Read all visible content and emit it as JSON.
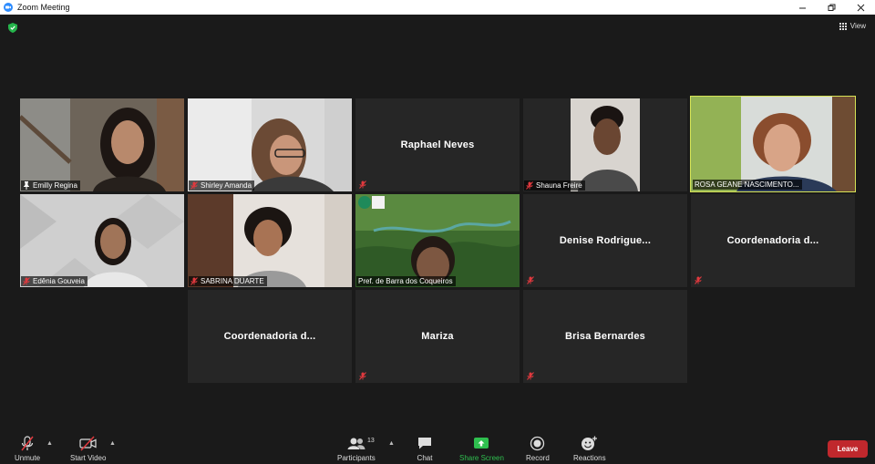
{
  "window": {
    "title": "Zoom Meeting",
    "app_icon": "zoom-camera-icon"
  },
  "top_bar": {
    "security_icon": "shield-check-icon",
    "view_label": "View"
  },
  "participants": [
    {
      "name": "Emilly Regina",
      "type": "video",
      "icon": "pin-icon"
    },
    {
      "name": "Shirley Amanda",
      "type": "video",
      "icon": "mic-muted-icon"
    },
    {
      "name": "Raphael Neves",
      "type": "name",
      "icon": "mic-muted-icon"
    },
    {
      "name": "Shauna Freire",
      "type": "video",
      "icon": "mic-muted-icon"
    },
    {
      "name": "ROSA GEANE NASCIMENTO...",
      "type": "video",
      "active_speaker": true
    },
    {
      "name": "Edênia Gouveia",
      "type": "video",
      "icon": "mic-muted-icon"
    },
    {
      "name": "SABRINA DUARTE",
      "type": "video",
      "icon": "mic-muted-icon"
    },
    {
      "name": "Pref. de Barra dos Coqueiros",
      "type": "video"
    },
    {
      "name": "Denise  Rodrigue...",
      "type": "name",
      "icon": "mic-muted-icon"
    },
    {
      "name": "Coordenadoria  d...",
      "type": "name",
      "icon": "mic-muted-icon"
    },
    {
      "name": "Coordenadoria  d...",
      "type": "name"
    },
    {
      "name": "Mariza",
      "type": "name",
      "icon": "mic-muted-icon"
    },
    {
      "name": "Brisa Bernardes",
      "type": "name",
      "icon": "mic-muted-icon"
    }
  ],
  "toolbar": {
    "unmute_label": "Unmute",
    "start_video_label": "Start Video",
    "participants_label": "Participants",
    "participants_count": "13",
    "chat_label": "Chat",
    "share_screen_label": "Share Screen",
    "record_label": "Record",
    "reactions_label": "Reactions",
    "leave_label": "Leave"
  },
  "colors": {
    "background": "#1a1a1a",
    "tile": "#262626",
    "active_speaker_border": "#d6e356",
    "share_green": "#2fbf4f",
    "leave_red": "#c0282d",
    "mute_red": "#e0393e"
  }
}
